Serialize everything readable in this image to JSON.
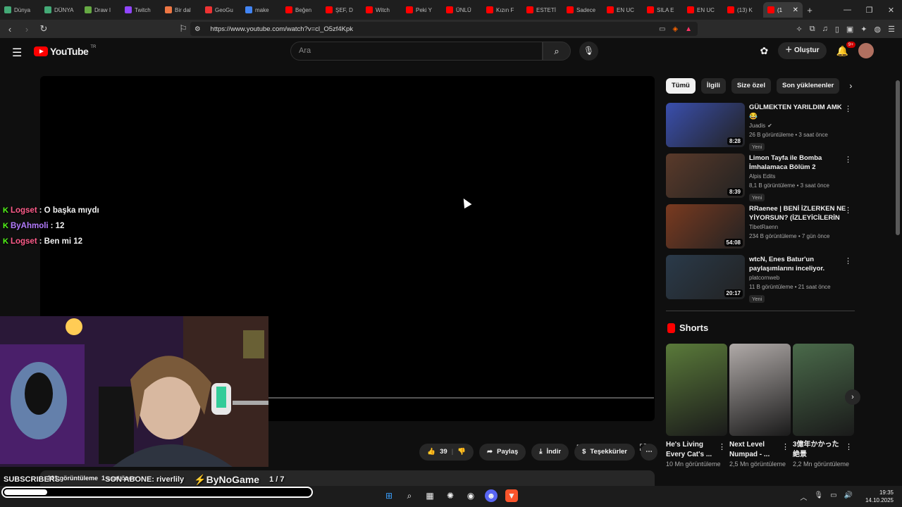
{
  "browser": {
    "tabs": [
      {
        "label": "Dünya",
        "color": "#4a7"
      },
      {
        "label": "DÜNYA",
        "color": "#4a7"
      },
      {
        "label": "Draw I",
        "color": "#6a4"
      },
      {
        "label": "Twitch",
        "color": "#9146ff"
      },
      {
        "label": "Bir dal",
        "color": "#e74"
      },
      {
        "label": "GeoGu",
        "color": "#e33"
      },
      {
        "label": "make",
        "color": "#4285f4"
      },
      {
        "label": "Beğen",
        "color": "#f00"
      },
      {
        "label": "ŞEF, D",
        "color": "#f00"
      },
      {
        "label": "Witch",
        "color": "#f00"
      },
      {
        "label": "Peki Y",
        "color": "#f00"
      },
      {
        "label": "ÜNLÜ",
        "color": "#f00"
      },
      {
        "label": "Kızın F",
        "color": "#f00"
      },
      {
        "label": "ESTETİ",
        "color": "#f00"
      },
      {
        "label": "Sadece",
        "color": "#f00"
      },
      {
        "label": "EN UC",
        "color": "#f00"
      },
      {
        "label": "SILA E",
        "color": "#f00"
      },
      {
        "label": "EN UC",
        "color": "#f00"
      },
      {
        "label": "(13) K",
        "color": "#f00"
      }
    ],
    "active_tab": {
      "label": "(1",
      "close": "✕"
    },
    "new_tab": "+",
    "window_controls": [
      "—",
      "❐",
      "✕"
    ],
    "url": "https://www.youtube.com/watch?v=cl_O5zf4Kpk"
  },
  "youtube": {
    "logo_text": "YouTube",
    "logo_region": "TR",
    "search_placeholder": "Ara",
    "create_label": "Oluştur",
    "notif_badge": "9+",
    "actions": {
      "like_count": "39",
      "share": "Paylaş",
      "download": "İndir",
      "thanks": "Teşekkürler",
      "more": "⋯"
    },
    "description": {
      "views": "261 görüntüleme",
      "time": "1 saat önce"
    },
    "chips": [
      "Tümü",
      "İlgili",
      "Size özel",
      "Son yüklenenler"
    ],
    "recommendations": [
      {
        "title": "GÜLMEKTEN YARILDIM AMK 😂",
        "channel": "Juadis",
        "verified": "✔",
        "meta": "26 B görüntüleme • 3 saat önce",
        "badge": "Yeni",
        "duration": "8:28",
        "color": "#3a4fae"
      },
      {
        "title": "Limon Tayfa ile Bomba İmhalamaca Bölüm 2",
        "channel": "Alpis Edits",
        "meta": "8,1 B görüntüleme • 3 saat önce",
        "badge": "Yeni",
        "duration": "8:39",
        "color": "#5a3a2a"
      },
      {
        "title": "RRaenee | BENİ İZLERKEN NE YİYORSUN? (İZLEYİCİLERİN ...",
        "channel": "TibetRaenn",
        "meta": "234 B görüntüleme • 7 gün önce",
        "badge": "",
        "duration": "54:08",
        "color": "#7a3a20"
      },
      {
        "title": "wtcN, Enes Batur'un paylaşımlarını inceliyor.",
        "channel": "platcornweb",
        "meta": "11 B görüntüleme • 21 saat önce",
        "badge": "Yeni",
        "duration": "20:17",
        "color": "#2a3a4a"
      }
    ],
    "shorts_title": "Shorts",
    "shorts": [
      {
        "title": "He's Living Every Cat's ...",
        "views": "10 Mn görüntüleme",
        "color": "#5a7a3a"
      },
      {
        "title": "Next Level Numpad - ...",
        "views": "2,5 Mn görüntüleme",
        "color": "#b0aaa8"
      },
      {
        "title": "3億年かかった絶景",
        "views": "2,2 Mn görüntüleme",
        "color": "#4a6a4a"
      }
    ]
  },
  "stream_overlay": {
    "chat": [
      {
        "user": "Logset",
        "user_color": "#ff5c8a",
        "msg": ": O başka mıydı"
      },
      {
        "user": "ByAhmoli",
        "user_color": "#b47cff",
        "msg": ": 12"
      },
      {
        "user": "Logset",
        "user_color": "#ff5c8a",
        "msg": ": Ben mi 12"
      }
    ],
    "subscribers_label": "SUBSCRIBERS",
    "son_abone": "SON ABONE: riverlily",
    "sponsor": "ByNoGame",
    "page_counter": "1  / 7",
    "progress_fraction": 0.14
  },
  "taskbar": {
    "time": "19:35",
    "date": "14.10.2025"
  }
}
